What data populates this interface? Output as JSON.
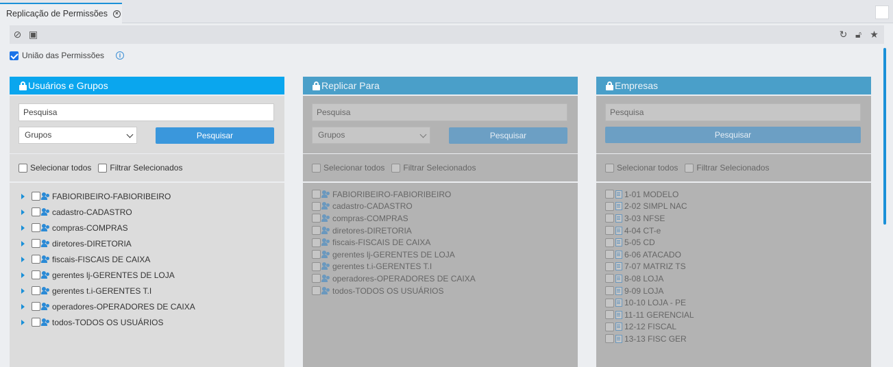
{
  "tab": {
    "title": "Replicação de Permissões"
  },
  "toolbar": {
    "left_icons": [
      "cancel-icon",
      "save-icon"
    ],
    "right_icons": [
      "refresh-icon",
      "lock-icon",
      "star-icon"
    ]
  },
  "union": {
    "label": "União das Permissões",
    "checked": true
  },
  "panels": [
    {
      "title": "Usuários e Grupos",
      "search_placeholder": "Pesquisa",
      "select_value": "Grupos",
      "button": "Pesquisar",
      "select_all": "Selecionar todos",
      "filter_selected": "Filtrar Selecionados",
      "items": [
        "FABIORIBEIRO-FABIORIBEIRO",
        "cadastro-CADASTRO",
        "compras-COMPRAS",
        "diretores-DIRETORIA",
        "fiscais-FISCAIS DE CAIXA",
        "gerentes lj-GERENTES DE LOJA",
        "gerentes t.i-GERENTES T.I",
        "operadores-OPERADORES DE CAIXA",
        "todos-TODOS OS USUÁRIOS"
      ]
    },
    {
      "title": "Replicar Para",
      "search_placeholder": "Pesquisa",
      "select_value": "Grupos",
      "button": "Pesquisar",
      "select_all": "Selecionar todos",
      "filter_selected": "Filtrar Selecionados",
      "items": [
        "FABIORIBEIRO-FABIORIBEIRO",
        "cadastro-CADASTRO",
        "compras-COMPRAS",
        "diretores-DIRETORIA",
        "fiscais-FISCAIS DE CAIXA",
        "gerentes lj-GERENTES DE LOJA",
        "gerentes t.i-GERENTES T.I",
        "operadores-OPERADORES DE CAIXA",
        "todos-TODOS OS USUÁRIOS"
      ]
    },
    {
      "title": "Empresas",
      "search_placeholder": "Pesquisa",
      "button": "Pesquisar",
      "select_all": "Selecionar todos",
      "filter_selected": "Filtrar Selecionados",
      "items": [
        "1-01 MODELO",
        "2-02 SIMPL NAC",
        "3-03 NFSE",
        "4-04 CT-e",
        "5-05 CD",
        "6-06 ATACADO",
        "7-07 MATRIZ TS",
        "8-08 LOJA",
        "9-09 LOJA",
        "10-10 LOJA - PE",
        "11-11 GERENCIAL",
        "12-12 FISCAL",
        "13-13 FISC GER"
      ]
    }
  ]
}
